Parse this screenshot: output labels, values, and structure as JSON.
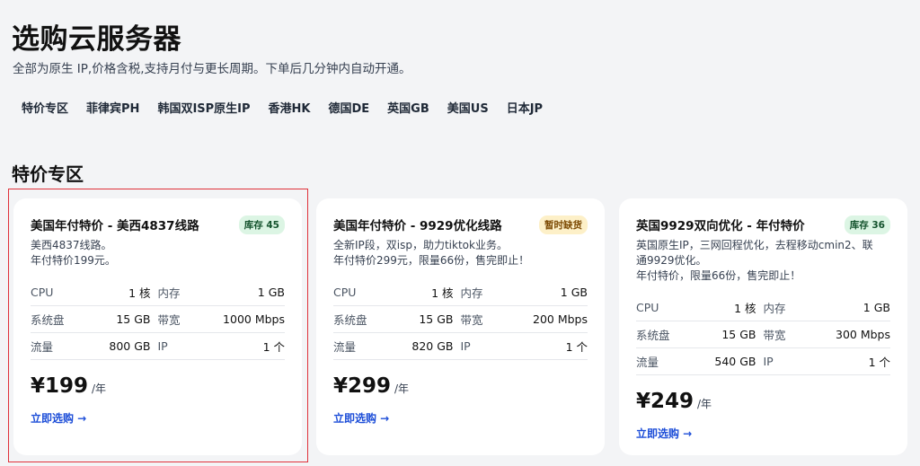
{
  "header": {
    "title": "选购云服务器",
    "subtitle": "全部为原生 IP,价格含税,支持月付与更长周期。下单后几分钟内自动开通。"
  },
  "tabs": [
    {
      "label": "特价专区"
    },
    {
      "label": "菲律宾PH"
    },
    {
      "label": "韩国双ISP原生IP"
    },
    {
      "label": "香港HK"
    },
    {
      "label": "德国DE"
    },
    {
      "label": "英国GB"
    },
    {
      "label": "美国US"
    },
    {
      "label": "日本JP"
    }
  ],
  "section": {
    "title": "特价专区"
  },
  "colors": {
    "accent": "#1d4ed8",
    "badge_green": "#dcf5e4",
    "badge_yellow": "#fdf0c8",
    "highlight": "#e0313a"
  },
  "cards": [
    {
      "name": "美国年付特价 - 美西4837线路",
      "badge": "库存 45",
      "desc": "美西4837线路。\n年付特价199元。",
      "specs": {
        "cpu_label": "CPU",
        "cpu": "1 核",
        "mem_label": "内存",
        "mem": "1 GB",
        "disk_label": "系统盘",
        "disk": "15 GB",
        "bw_label": "带宽",
        "bw": "1000 Mbps",
        "traffic_label": "流量",
        "traffic": "800 GB",
        "ip_label": "IP",
        "ip": "1 个"
      },
      "price": "¥199",
      "unit": "/年",
      "link": "立即选购 →"
    },
    {
      "name": "美国年付特价 - 9929优化线路",
      "badge": "暂时缺货",
      "desc": "全新IP段，双isp，助力tiktok业务。\n年付特价299元，限量66份，售完即止！",
      "specs": {
        "cpu_label": "CPU",
        "cpu": "1 核",
        "mem_label": "内存",
        "mem": "1 GB",
        "disk_label": "系统盘",
        "disk": "15 GB",
        "bw_label": "带宽",
        "bw": "200 Mbps",
        "traffic_label": "流量",
        "traffic": "820 GB",
        "ip_label": "IP",
        "ip": "1 个"
      },
      "price": "¥299",
      "unit": "/年",
      "link": "立即选购 →"
    },
    {
      "name": "英国9929双向优化 - 年付特价",
      "badge": "库存 36",
      "desc": "英国原生IP，三网回程优化，去程移动cmin2、联\n通9929优化。\n年付特价，限量66份，售完即止！",
      "specs": {
        "cpu_label": "CPU",
        "cpu": "1 核",
        "mem_label": "内存",
        "mem": "1 GB",
        "disk_label": "系统盘",
        "disk": "15 GB",
        "bw_label": "带宽",
        "bw": "300 Mbps",
        "traffic_label": "流量",
        "traffic": "540 GB",
        "ip_label": "IP",
        "ip": "1 个"
      },
      "price": "¥249",
      "unit": "/年",
      "link": "立即选购 →"
    }
  ]
}
